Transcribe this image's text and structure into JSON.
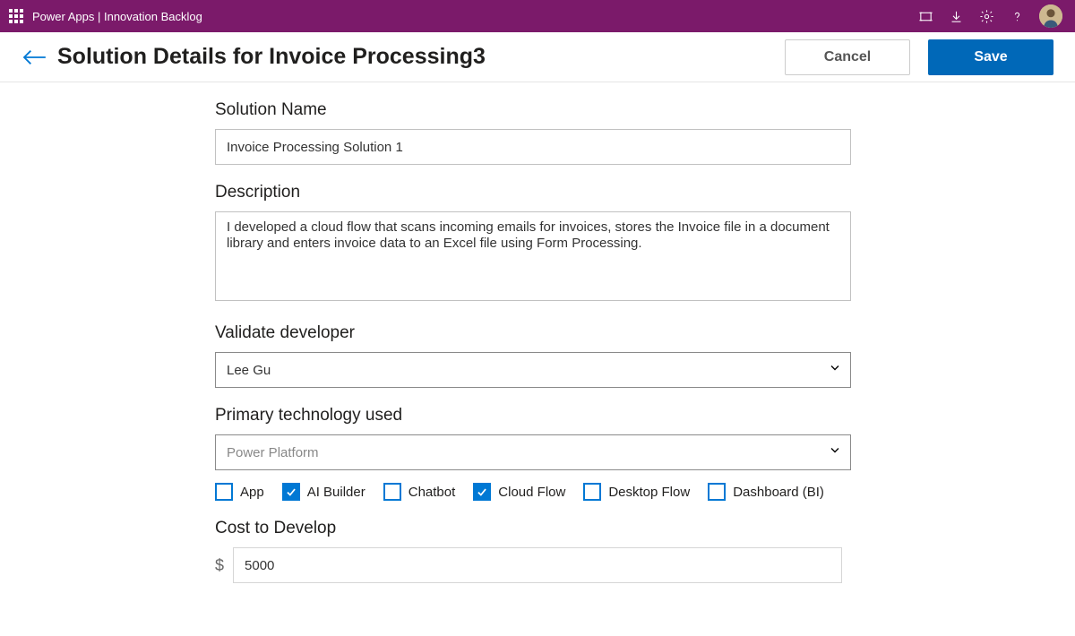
{
  "topbar": {
    "title": "Power Apps  |  Innovation Backlog"
  },
  "header": {
    "title": "Solution Details for Invoice Processing3",
    "cancel_label": "Cancel",
    "save_label": "Save"
  },
  "form": {
    "solution_name_label": "Solution Name",
    "solution_name_value": "Invoice Processing Solution 1",
    "description_label": "Description",
    "description_value": "I developed a cloud flow that scans incoming emails for invoices, stores the Invoice file in a document library and enters invoice data to an Excel file using Form Processing.",
    "validate_developer_label": "Validate developer",
    "validate_developer_value": "Lee Gu",
    "primary_tech_label": "Primary technology used",
    "primary_tech_value": "Power Platform",
    "checkboxes": [
      {
        "label": "App",
        "checked": false
      },
      {
        "label": "AI Builder",
        "checked": true
      },
      {
        "label": "Chatbot",
        "checked": false
      },
      {
        "label": "Cloud Flow",
        "checked": true
      },
      {
        "label": "Desktop Flow",
        "checked": false
      },
      {
        "label": "Dashboard (BI)",
        "checked": false
      }
    ],
    "cost_label": "Cost to Develop",
    "cost_currency": "$",
    "cost_value": "5000"
  }
}
